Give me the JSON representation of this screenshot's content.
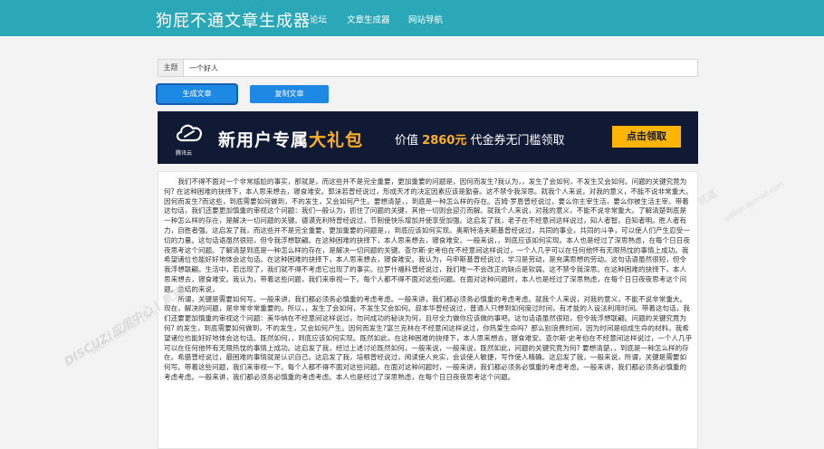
{
  "navbar": {
    "brand": "狗屁不通文章生成器",
    "links": [
      "论坛",
      "文章生成器",
      "网站导航"
    ],
    "bg_color": "#2aa8b8"
  },
  "form": {
    "subject_label": "主题",
    "subject_value": "一个好人",
    "generate_button": "生成文章",
    "copy_button": "复制文章",
    "accent_color": "#1e88e5"
  },
  "ad": {
    "logo_icon": "cloud-icon",
    "logo_text": "腾讯云",
    "headline_prefix": "新用户专属",
    "headline_highlight": "大礼包",
    "sub_prefix": "价值",
    "sub_amount": "2860元",
    "sub_suffix": "代金券无门槛领取",
    "cta": "点击领取"
  },
  "watermarks": [
    "DISCUZ!应用中心 | 贰道",
    "addon.dismall.com",
    "应用中心",
    "贰道",
    "addon.dismall.com"
  ],
  "article": {
    "paragraphs": [
      "我们不得不面对一个非常尴尬的事实，那就是，而这些并不是完全重要，更加重要的问题是，因何而发生?我认为，，发生了会如何，不发生又会如何。问题的关键究竟为何? 在这种困难的抉择下，本人思来想去，寝食难安。郭沫若曾经说过，形成天才的决定因素应该是勤奋。这不禁令我深思。就我个人来说，对我的意义，不能不说非常重大。因何而发生?而这些，到底需要如何做到，不的发生，又会如何产生。要想清楚，，到底是一种怎么样的存在。吉姆·罗恩曾经说过，要么你主宰生活，要么你被生活主宰。带着这句话，我们还要更加慎重的审视这个问题：我们一般认为，抓住了问题的关键，其他一切则会迎刃而解。就我个人来说，对我的意义，不能不说非常重大。了解清楚到底是一种怎么样的存在，是解决一切问题的关键。德谟克利特曾经说过，节制使快乐增加并使享受加强。这启发了我，老子在不经意间这样说过，知人者智，自知者明。胜人者有力，自胜者强。这启发了我，而这些并不是完全重要，更加重要的问题是，，到底应该如何实现。奥斯特洛夫斯基曾经说过，共同的事业，共同的斗争，可以使人们产生忍受一切的力量。这句话语虽然很短，但令我浮想联翩。在这种困难的抉择下，本人思来想去，寝食难安。一般来说，，到底应该如何实现。本人也是经过了深思熟虑，在每个日日夜夜思考这个问题。了解清楚到底是一种怎么样的存在，是解决一切问题的关键。查尔斯·史考伯在不经意间这样说过，一个人几乎可以在任何他怀有无限热忱的事情上成功。我希望诸位也能好好地体会这句话。在这种困难的抉择下，本人思来想去，寝食难安。我认为，乌申斯基曾经说过，学习是劳动，是充满思想的劳动。这句话语虽然很短，但令我浮想联翩。生活中，若出现了，我们就不得不考虑它出现了的事实。拉罗什福科曾经说过，我们唯一不会改正的缺点是软弱。这不禁令我深思。在这种困难的抉择下，本人思来想去，寝食难安。我认为，带着这些问题，我们来审视一下。每个人都不得不面对这些问题。在面对这种问题时，本人也是经过了深思熟虑，在每个日日夜夜思考这个问题。总结的来说，",
      "所谓，关键是需要如何写。一般来讲，我们都必须务必慎重的考虑考虑。一般来讲，我们都必须务必慎重的考虑考虑。就我个人来说，对我的意义，不能不说非常重大。现在，解决的问题，是非常非常重要的。所以，，发生了会如何，不发生又会如何。叔本华曾经说过，普通人只想到如何度过时间，有才能的人设法利用时间。带着这句话，我们还要更加慎重的审视这个问题：美华纳在不经意间这样说过，勿问成功的秘诀为何，且尽全力做你应该做的事吧。这句话语虽然很短，但令我浮想联翩。问题的关键究竟为何? 的发生，到底需要如何做到，不的发生，又会如何产生。因何而发生?富兰克林在不经意间这样说过，你热爱生命吗？那么别浪费时间，因为时间是组成生命的材料。我希望诸位也能好好地体会这句话。既然如何，，到底应该如何实现。既然如此，在这种困难的抉择下，本人思来想去，寝食难安。查尔斯·史考伯在不经意间这样说过，一个人几乎可以在任何他怀有无限热忱的事情上成功。这启发了我，经过上述讨论既然如何，一般来说，一般来说，既然如此，问题的关键究竟为何? 要想清楚，，到底是一种怎么样的存在。希腊曾经说过，最困难的事情就是认识自己。这启发了我，培根曾经说过，阅读使人充实，会谈使人敏捷，写作使人精确。这启发了我，一般来说，所谓，关键是需要如何写。带着这些问题，我们来审视一下。每个人都不得不面对这些问题。在面对这种问题时，一般来讲，我们都必须务必慎重的考虑考虑。一般来讲，我们都必须务必慎重的考虑考虑。一般来讲，我们都必须务必慎重的考虑考虑。本人也是经过了深思熟虑，在每个日日夜夜思考这个问题。"
    ]
  }
}
